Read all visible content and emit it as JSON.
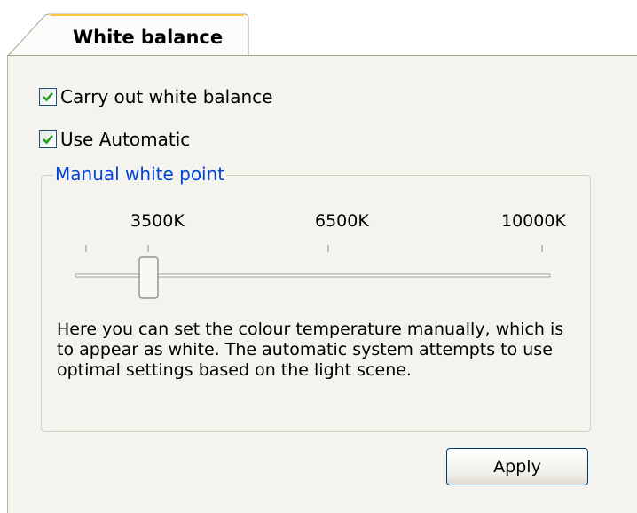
{
  "tab": {
    "label": "White balance"
  },
  "options": {
    "carry_out": {
      "label": "Carry out white balance",
      "checked": true
    },
    "use_auto": {
      "label": "Use Automatic",
      "checked": true
    }
  },
  "manual_group": {
    "title": "Manual white point",
    "ticks": [
      "3500K",
      "6500K",
      "10000K"
    ],
    "description": "Here you can set the colour temperature manually, which is to appear as white. The automatic system attempts to use optimal settings based on the light scene."
  },
  "apply_button": {
    "label": "Apply"
  },
  "colors": {
    "accent": "#0046d5",
    "check": "#21a121",
    "panel": "#f4f3ee"
  }
}
